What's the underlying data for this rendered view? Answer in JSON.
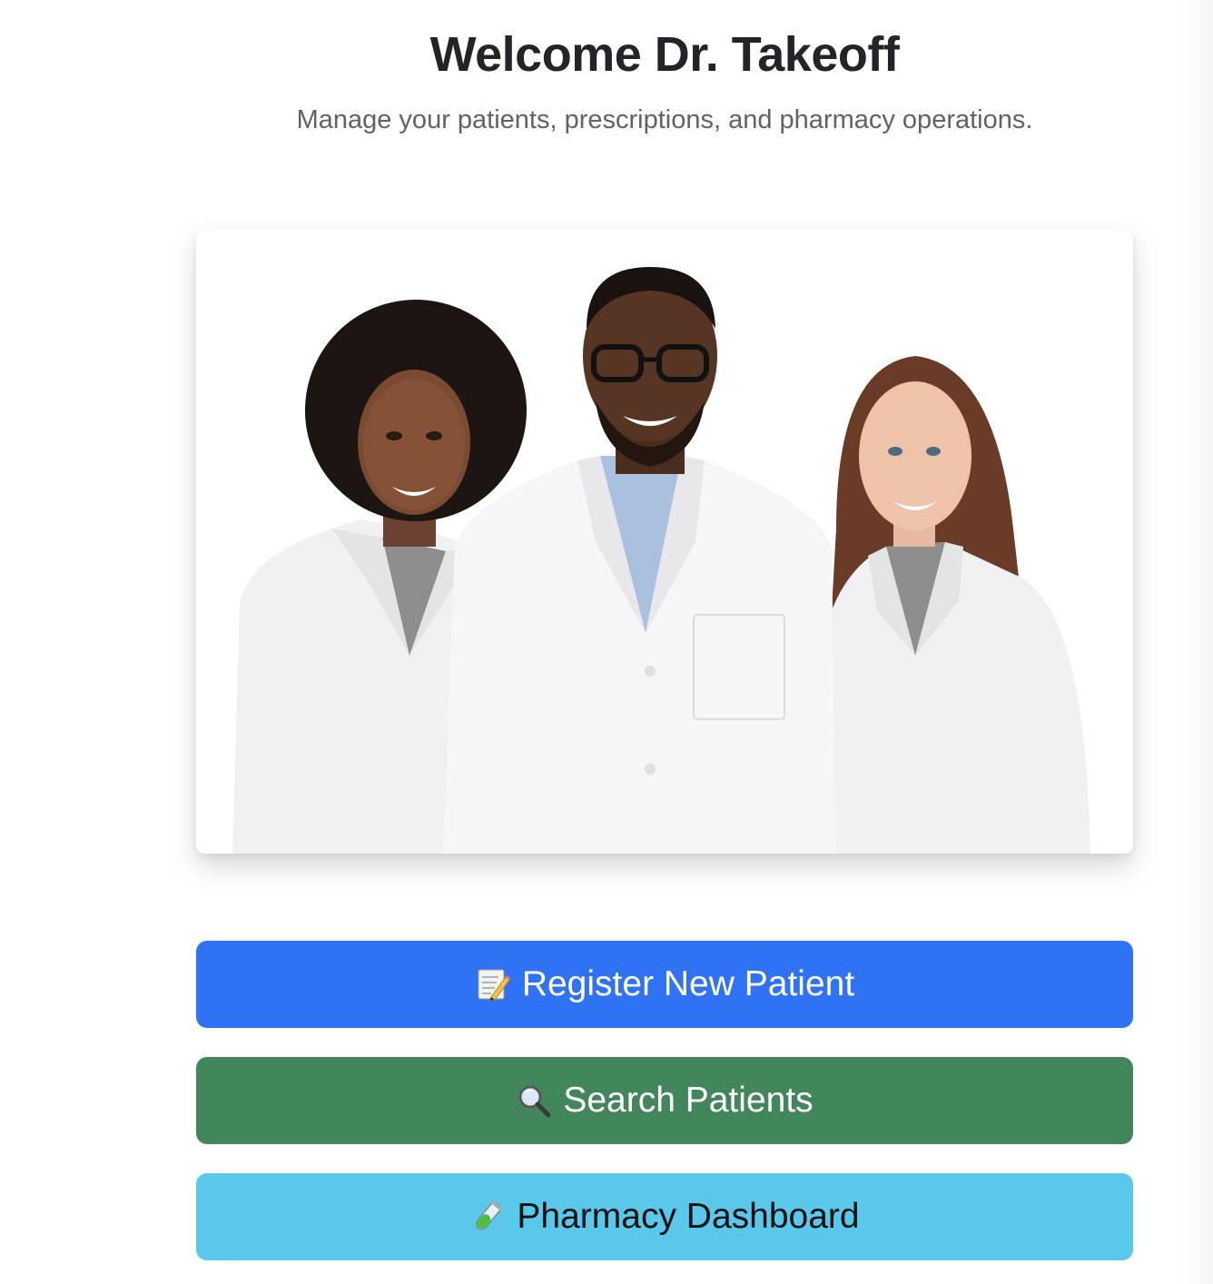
{
  "header": {
    "title": "Welcome Dr. Takeoff",
    "subtitle": "Manage your patients, prescriptions, and pharmacy operations."
  },
  "hero": {
    "icon": "team-photo"
  },
  "actions": [
    {
      "label": "Register New Patient",
      "icon": "memo-icon",
      "color": "#2f72f3",
      "text_color": "#ffffff"
    },
    {
      "label": "Search Patients",
      "icon": "magnifier-icon",
      "color": "#42865c",
      "text_color": "#ffffff"
    },
    {
      "label": "Pharmacy Dashboard",
      "icon": "test-tube-icon",
      "color": "#5ac8ea",
      "text_color": "#111111"
    }
  ]
}
